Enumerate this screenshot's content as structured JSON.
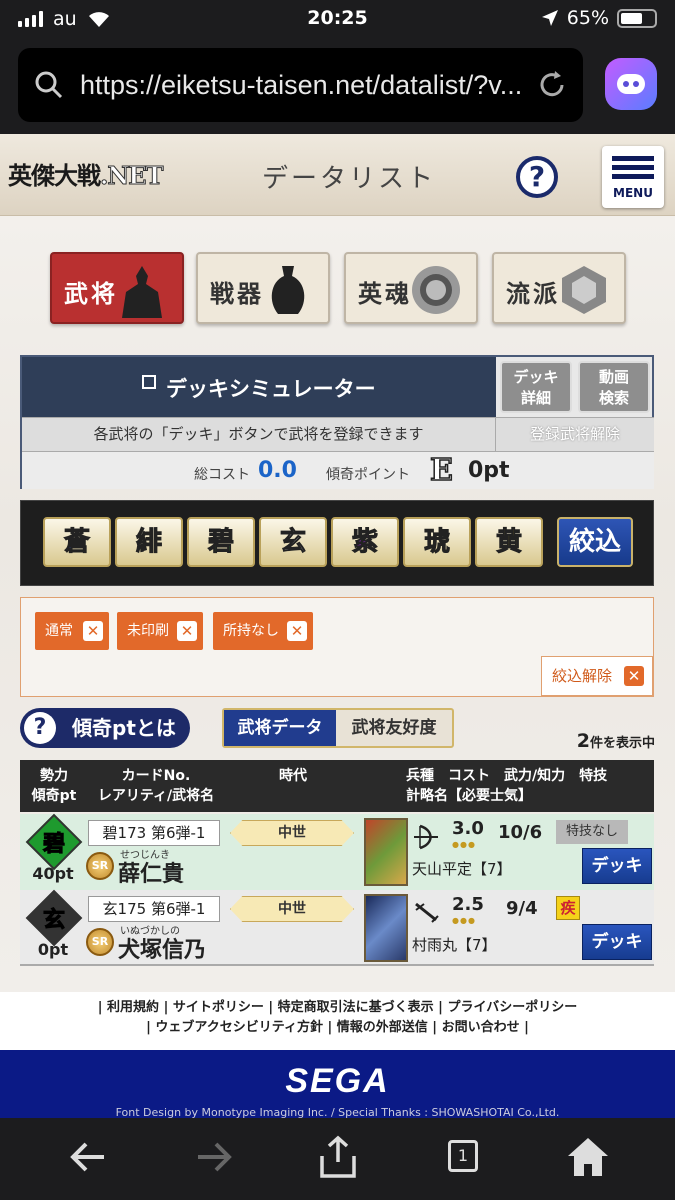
{
  "status": {
    "carrier": "au",
    "time": "20:25",
    "battery": "65%",
    "battery_level": 0.65
  },
  "browser": {
    "url": "https://eiketsu-taisen.net/datalist/?v...",
    "icons": [
      "search-icon",
      "reload-icon",
      "bot-icon"
    ]
  },
  "header": {
    "logo_main": "英傑大戦",
    "logo_net": ".NET",
    "title": "データリスト",
    "help": "?",
    "menu": "MENU"
  },
  "categories": [
    {
      "label": "武将",
      "active": true
    },
    {
      "label": "戦器",
      "active": false
    },
    {
      "label": "英魂",
      "active": false
    },
    {
      "label": "流派",
      "active": false
    }
  ],
  "deck_sim": {
    "title": "デッキシミュレーター",
    "btn_detail_1": "デッキ",
    "btn_detail_2": "詳細",
    "btn_video_1": "動画",
    "btn_video_2": "検索",
    "instruction": "各武将の「デッキ」ボタンで武将を登録できます",
    "release": "登録武将解除",
    "cost_label": "総コスト",
    "cost_value": "0.0",
    "kei_label": "傾奇ポイント",
    "rank": "E",
    "pt": "0pt"
  },
  "factions": [
    {
      "label": "蒼",
      "color": "#2340c8"
    },
    {
      "label": "緋",
      "color": "#d3201e"
    },
    {
      "label": "碧",
      "color": "#1e9a2e"
    },
    {
      "label": "玄",
      "color": "#333333"
    },
    {
      "label": "紫",
      "color": "#8a2ab8"
    },
    {
      "label": "琥",
      "color": "#d8701a"
    },
    {
      "label": "黄",
      "color": "#d9b81a"
    }
  ],
  "filter_button": "絞込",
  "tags": [
    "通常",
    "未印刷",
    "所持なし"
  ],
  "tag_close": "✕",
  "clear_filter": "絞込解除",
  "keipt": {
    "q": "?",
    "label": "傾奇ptとは"
  },
  "tabs": {
    "data": "武将データ",
    "friend": "武将友好度"
  },
  "result_count": {
    "num": "2",
    "suffix": "件を表示中"
  },
  "table_header": {
    "c1a": "勢力",
    "c1b": "傾奇pt",
    "c2a": "カードNo.",
    "c2b": "レアリティ/武将名",
    "c3": "時代",
    "c4a": "兵種　コスト　武力/知力　特技",
    "c4b": "計略名【必要士気】"
  },
  "rows": [
    {
      "faction": "碧",
      "pt": "40pt",
      "card_no": "碧173 第6弾-1",
      "rarity": "SR",
      "ruby": "せつじんき",
      "name": "薛仁貴",
      "era": "中世",
      "cost": "3.0",
      "dots": "●●●",
      "stat": "10/6",
      "skill": "特技なし",
      "strategy": "天山平定【7】",
      "deck": "デッキ"
    },
    {
      "faction": "玄",
      "pt": "0pt",
      "card_no": "玄175 第6弾-1",
      "rarity": "SR",
      "ruby": "いぬづかしの",
      "name": "犬塚信乃",
      "era": "中世",
      "cost": "2.5",
      "dots": "●●●",
      "stat": "9/4",
      "skill": "疾",
      "strategy": "村雨丸【7】",
      "deck": "デッキ"
    }
  ],
  "footer": {
    "line1": "| 利用規約 | サイトポリシー | 特定商取引法に基づく表示 | プライバシーポリシー",
    "line2": "| ウェブアクセシビリティ方針 | 情報の外部送信 | お問い合わせ |",
    "sega": "SEGA",
    "credit": "Font Design by Monotype Imaging Inc. / Special Thanks : SHOWASHOTAI Co.,Ltd."
  },
  "toolbar": {
    "tabs_count": "1"
  }
}
